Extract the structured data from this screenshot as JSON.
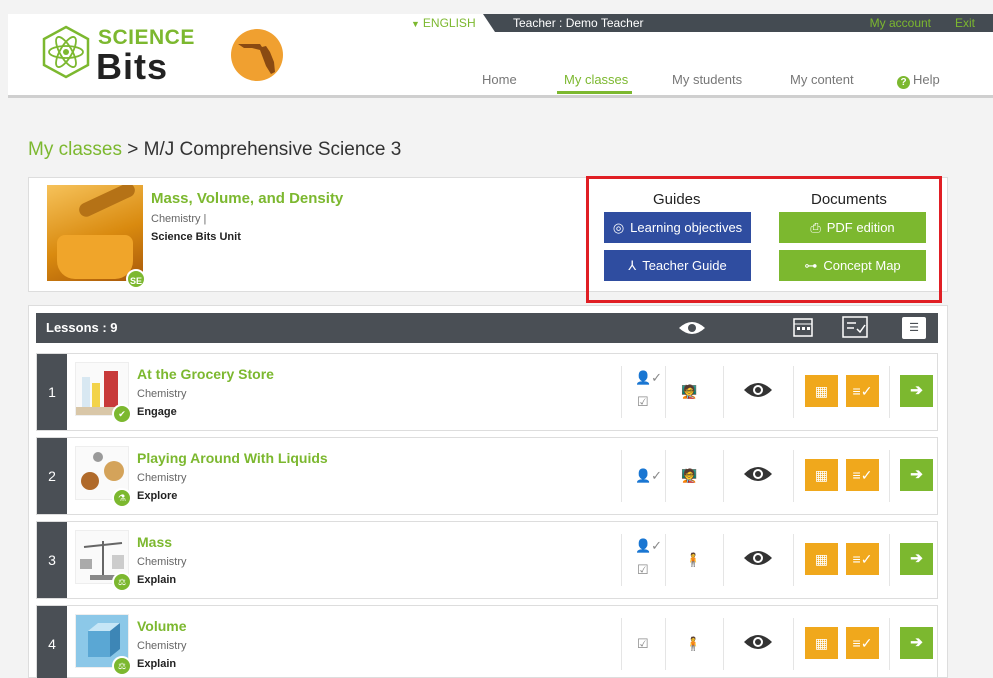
{
  "topbar": {
    "language": "ENGLISH",
    "teacher": "Teacher : Demo Teacher",
    "my_account": "My account",
    "exit": "Exit"
  },
  "logo": {
    "line1": "SCIENCE",
    "line2": "Bits"
  },
  "nav": {
    "home": "Home",
    "my_classes": "My classes",
    "my_students": "My students",
    "my_content": "My content",
    "help": "Help"
  },
  "breadcrumb": {
    "link": "My classes",
    "separator": ">",
    "current": "M/J Comprehensive Science 3"
  },
  "unit": {
    "title": "Mass, Volume, and Density",
    "subject": "Chemistry |",
    "type": "Science Bits Unit",
    "badge": "SE"
  },
  "guides": {
    "heading": "Guides",
    "learning_objectives": "Learning objectives",
    "teacher_guide": "Teacher Guide"
  },
  "documents": {
    "heading": "Documents",
    "pdf_edition": "PDF edition",
    "concept_map": "Concept Map"
  },
  "lessons": {
    "title": "Lessons : 9",
    "items": [
      {
        "number": "1",
        "title": "At the Grocery Store",
        "subject": "Chemistry",
        "phase": "Engage"
      },
      {
        "number": "2",
        "title": "Playing Around With Liquids",
        "subject": "Chemistry",
        "phase": "Explore"
      },
      {
        "number": "3",
        "title": "Mass",
        "subject": "Chemistry",
        "phase": "Explain"
      },
      {
        "number": "4",
        "title": "Volume",
        "subject": "Chemistry",
        "phase": "Explain"
      }
    ]
  },
  "colors": {
    "brand_green": "#7cb82f",
    "guide_blue": "#2f4da0",
    "orange": "#f0a81c",
    "dark_bar": "#4a4f55",
    "highlight_red": "#e01e24"
  }
}
